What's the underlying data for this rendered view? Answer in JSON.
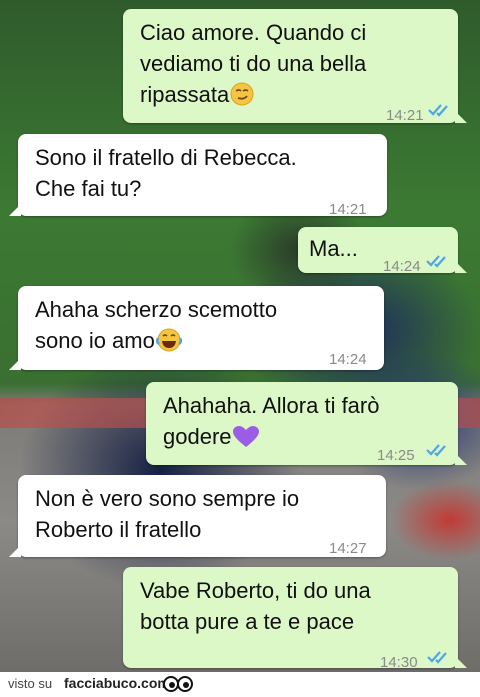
{
  "messages": [
    {
      "direction": "outgoing",
      "text": "Ciao amore. Quando ci\nvediamo ti do una bella\nripassata",
      "emoji": "smirk-emoji-icon",
      "time": "14:21",
      "status": "read"
    },
    {
      "direction": "incoming",
      "text": "Sono il fratello di Rebecca.\nChe fai tu?",
      "time": "14:21"
    },
    {
      "direction": "outgoing",
      "text": "Ma...",
      "time": "14:24",
      "status": "read"
    },
    {
      "direction": "incoming",
      "text": "Ahaha scherzo scemotto\nsono io amo",
      "emoji": "laughing-tears-emoji-icon",
      "time": "14:24"
    },
    {
      "direction": "outgoing",
      "text": "Ahahaha. Allora ti farò\ngodere",
      "emoji": "purple-heart-emoji-icon",
      "time": "14:25",
      "status": "read"
    },
    {
      "direction": "incoming",
      "text": "Non è vero sono sempre io\nRoberto il fratello",
      "time": "14:27"
    },
    {
      "direction": "outgoing",
      "text": "Vabe Roberto, ti do una\nbotta pure a te e pace",
      "time": "14:30",
      "status": "read"
    }
  ],
  "footer": {
    "prefix": "visto su",
    "site": "facciabuco.com"
  },
  "colors": {
    "outgoing_bubble": "#dcf8c6",
    "incoming_bubble": "#ffffff",
    "read_ticks": "#4fa5e8",
    "timestamp": "#8a8a8a"
  }
}
